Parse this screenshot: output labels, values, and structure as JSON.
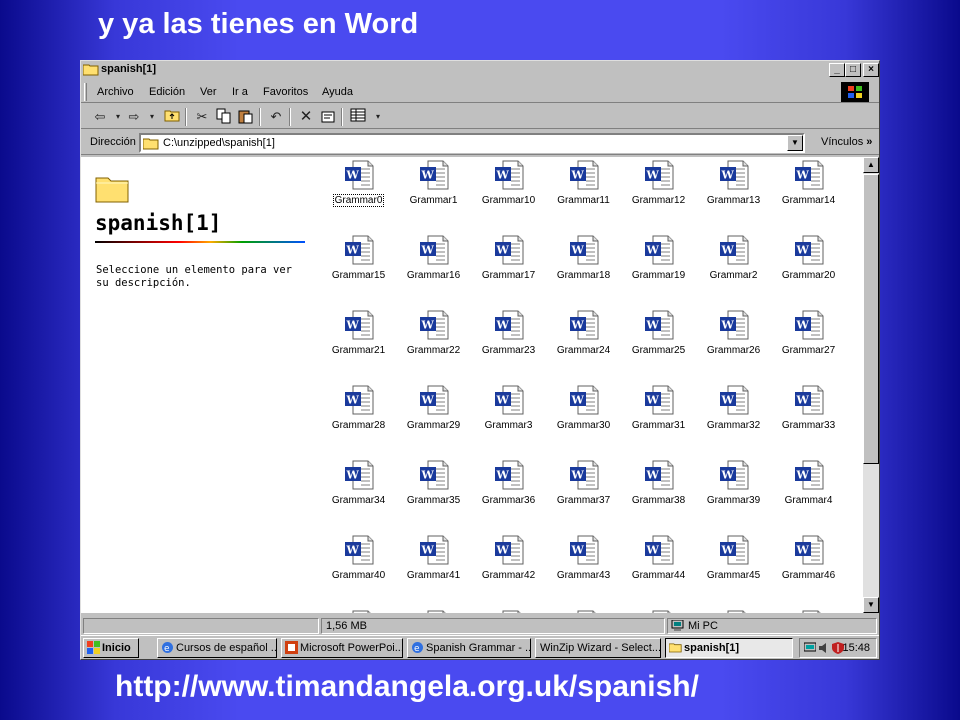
{
  "slide": {
    "title": "y ya las tienes en Word",
    "url": "http://www.timandangela.org.uk/spanish/"
  },
  "window": {
    "title": "spanish[1]",
    "controls": [
      "_",
      "□",
      "×"
    ]
  },
  "menu": [
    "Archivo",
    "Edición",
    "Ver",
    "Ir a",
    "Favoritos",
    "Ayuda"
  ],
  "toolbar": {
    "icons": [
      "back-icon",
      "forward-icon",
      "up-folder-icon",
      "cut-icon",
      "copy-icon",
      "paste-icon",
      "undo-icon",
      "delete-icon",
      "properties-icon",
      "views-icon"
    ]
  },
  "address": {
    "label": "Dirección",
    "path": "C:\\unzipped\\spanish[1]",
    "links_label": "Vínculos",
    "more": "»"
  },
  "left_pane": {
    "folder_title": "spanish[1]",
    "description": "Seleccione un elemento para ver su descripción."
  },
  "files": [
    "Grammar0",
    "Grammar1",
    "Grammar10",
    "Grammar11",
    "Grammar12",
    "Grammar13",
    "Grammar14",
    "Grammar15",
    "Grammar16",
    "Grammar17",
    "Grammar18",
    "Grammar19",
    "Grammar2",
    "Grammar20",
    "Grammar21",
    "Grammar22",
    "Grammar23",
    "Grammar24",
    "Grammar25",
    "Grammar26",
    "Grammar27",
    "Grammar28",
    "Grammar29",
    "Grammar3",
    "Grammar30",
    "Grammar31",
    "Grammar32",
    "Grammar33",
    "Grammar34",
    "Grammar35",
    "Grammar36",
    "Grammar37",
    "Grammar38",
    "Grammar39",
    "Grammar4",
    "Grammar40",
    "Grammar41",
    "Grammar42",
    "Grammar43",
    "Grammar44",
    "Grammar45",
    "Grammar46"
  ],
  "selected_file": "Grammar0",
  "status": {
    "size": "1,56 MB",
    "location": "Mi PC"
  },
  "taskbar": {
    "start": "Inicio",
    "buttons": [
      "Cursos de español ...",
      "Microsoft PowerPoi...",
      "Spanish Grammar - ...",
      "WinZip Wizard - Select...",
      "spanish[1]"
    ],
    "active": "spanish[1]",
    "clock": "15:48"
  },
  "colors": {
    "background": "#4a4af0",
    "window": "#c0c0c0",
    "word_icon_blue": "#1a3a9c"
  }
}
